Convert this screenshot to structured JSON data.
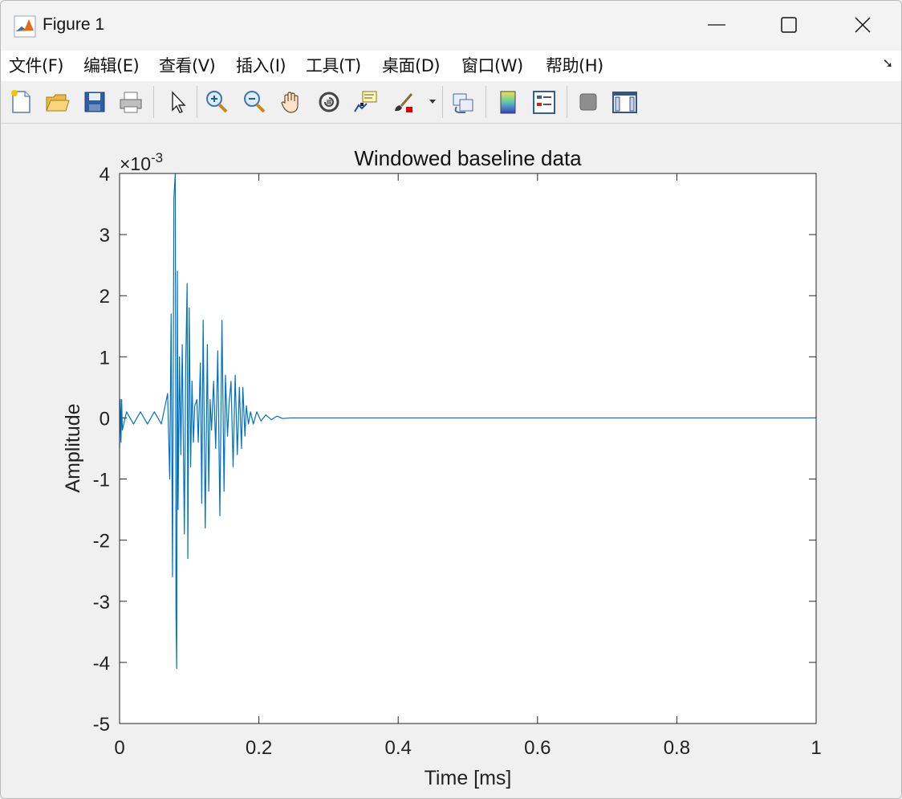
{
  "window": {
    "title": "Figure 1"
  },
  "menu": [
    "文件(F)",
    "编辑(E)",
    "查看(V)",
    "插入(I)",
    "工具(T)",
    "桌面(D)",
    "窗口(W)",
    "帮助(H)"
  ],
  "toolbar_icons": [
    "new-figure-icon",
    "open-file-icon",
    "save-icon",
    "print-icon",
    "pointer-icon",
    "zoom-in-icon",
    "zoom-out-icon",
    "pan-icon",
    "rotate-3d-icon",
    "data-cursor-icon",
    "brush-icon",
    "link-plot-icon",
    "colorbar-icon",
    "legend-icon",
    "hide-plot-tools-icon",
    "show-plot-tools-icon"
  ],
  "chart_data": {
    "type": "line",
    "title": "Windowed baseline data",
    "xlabel": "Time [ms]",
    "ylabel": "Amplitude",
    "y_exponent_label": "×10",
    "y_exponent_power": "-3",
    "xlim": [
      0,
      1
    ],
    "ylim": [
      -5,
      4
    ],
    "x_ticks": [
      "0",
      "0.2",
      "0.4",
      "0.6",
      "0.8",
      "1"
    ],
    "y_ticks": [
      "-5",
      "-4",
      "-3",
      "-2",
      "-1",
      "0",
      "1",
      "2",
      "3",
      "4"
    ],
    "grid": false,
    "line_color": "#0072BD",
    "series": [
      {
        "x": [
          0,
          0.001,
          0.002,
          0.003,
          0.004,
          0.01,
          0.02,
          0.03,
          0.04,
          0.05,
          0.06,
          0.069,
          0.072,
          0.074,
          0.076,
          0.078,
          0.08,
          0.081,
          0.082,
          0.083,
          0.084,
          0.086,
          0.088,
          0.09,
          0.093,
          0.095,
          0.097,
          0.098,
          0.1,
          0.102,
          0.104,
          0.106,
          0.108,
          0.111,
          0.113,
          0.116,
          0.118,
          0.12,
          0.123,
          0.126,
          0.128,
          0.13,
          0.132,
          0.135,
          0.138,
          0.141,
          0.144,
          0.147,
          0.15,
          0.152,
          0.155,
          0.157,
          0.16,
          0.163,
          0.166,
          0.169,
          0.172,
          0.175,
          0.177,
          0.18,
          0.182,
          0.185,
          0.188,
          0.192,
          0.197,
          0.203,
          0.21,
          0.218,
          0.226,
          0.234,
          0.245,
          0.3,
          0.4,
          0.5,
          0.6,
          0.7,
          0.8,
          0.9,
          1.0
        ],
        "y": [
          -0.0005,
          0.0003,
          -0.0004,
          0.0003,
          -0.0002,
          0.0001,
          -0.0001,
          0.0001,
          -0.0001,
          0.0001,
          -0.0001,
          0.0004,
          -0.001,
          0.0017,
          -0.0026,
          0.0036,
          0.004,
          -0.0032,
          -0.0041,
          0.0024,
          -0.0015,
          0.001,
          -0.0006,
          0.0012,
          -0.0019,
          0.0009,
          0.0022,
          -0.0023,
          0.0018,
          -0.0008,
          0.0006,
          -0.0004,
          0.0002,
          0.0003,
          -0.0004,
          0.0009,
          -0.0014,
          0.0016,
          -0.0018,
          0.0012,
          -0.0012,
          0.0003,
          -0.0002,
          0.0006,
          -0.0005,
          0.0011,
          -0.0016,
          0.0016,
          -0.0012,
          0.0007,
          -0.0003,
          0.0002,
          0.0006,
          -0.0008,
          0.0007,
          -0.0006,
          0.0005,
          -0.0005,
          0.0005,
          -0.0003,
          0.0002,
          -0.0001,
          0.0001,
          -0.0001,
          0.0001,
          -5e-05,
          5e-05,
          -3e-05,
          3e-05,
          -1e-05,
          0,
          0,
          0,
          0,
          0,
          0,
          0,
          0,
          0
        ]
      }
    ]
  }
}
